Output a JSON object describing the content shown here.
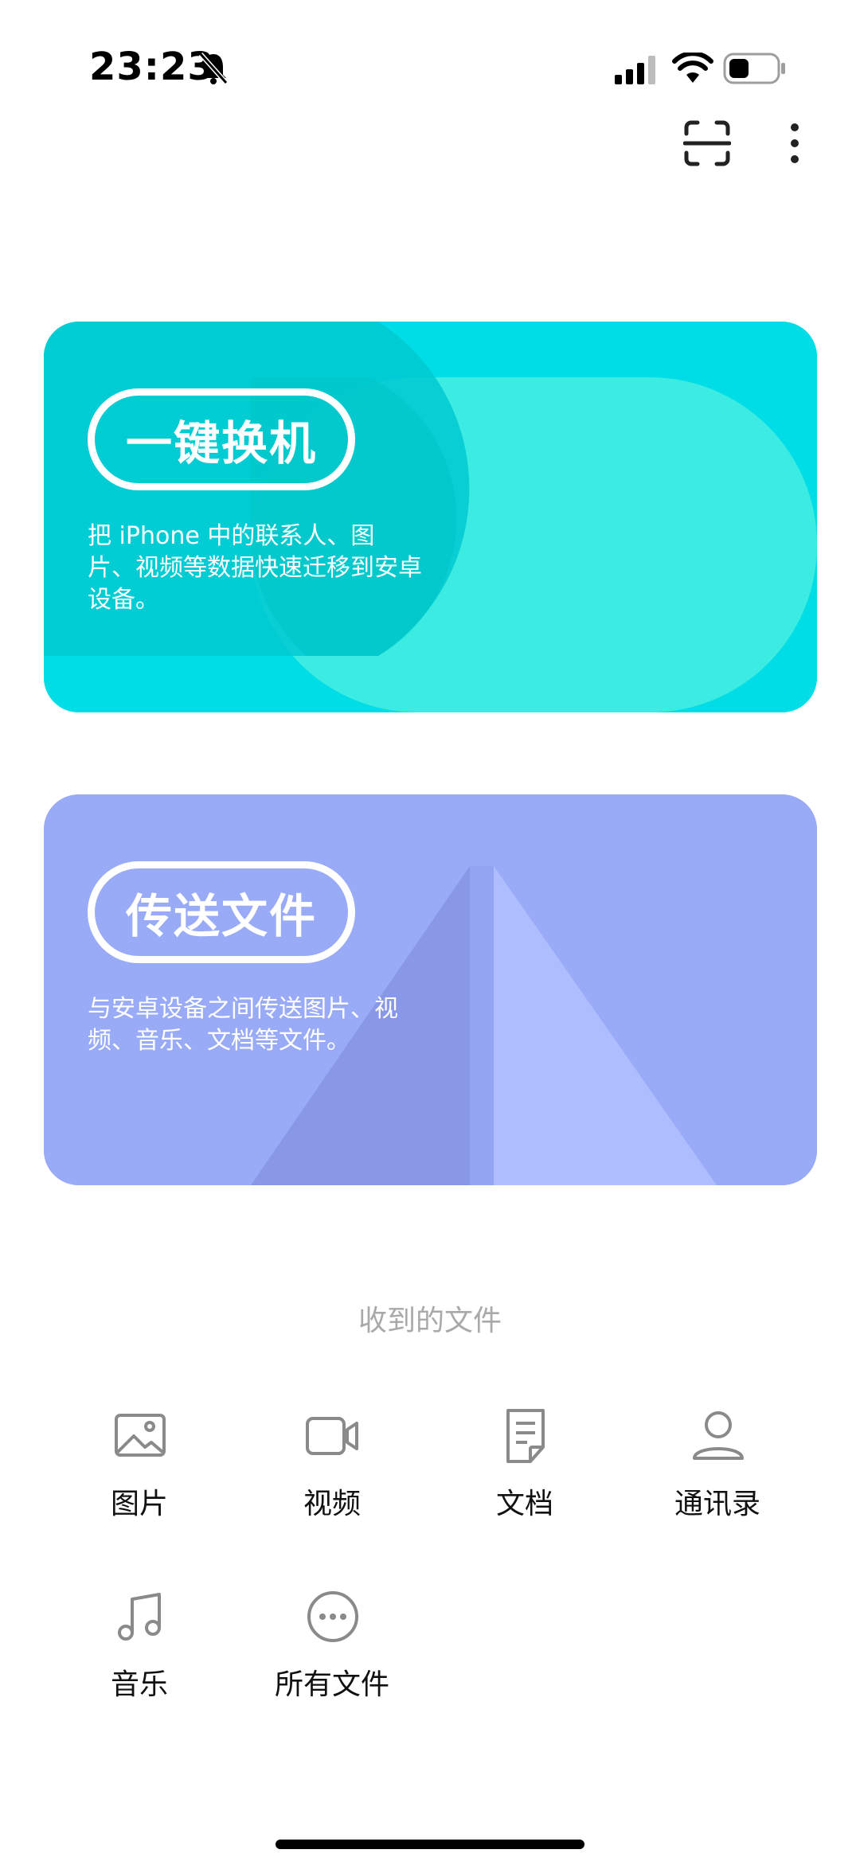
{
  "status_bar": {
    "time": "23:23",
    "icons": [
      "bell-muted-icon",
      "signal-icon",
      "wifi-icon",
      "battery-icon"
    ]
  },
  "toolbar": {
    "icons": [
      "scan-icon",
      "more-icon"
    ]
  },
  "cards": {
    "switch": {
      "title": "一键换机",
      "description": "把 iPhone 中的联系人、图片、视频等数据快速迁移到安卓设备。",
      "color": "#00dde6"
    },
    "transfer": {
      "title": "传送文件",
      "description": "与安卓设备之间传送图片、视频、音乐、文档等文件。",
      "color": "#99abf7"
    }
  },
  "received": {
    "title": "收到的文件",
    "items": [
      {
        "label": "图片",
        "icon": "image-icon"
      },
      {
        "label": "视频",
        "icon": "video-icon"
      },
      {
        "label": "文档",
        "icon": "document-icon"
      },
      {
        "label": "通讯录",
        "icon": "contact-icon"
      },
      {
        "label": "音乐",
        "icon": "music-icon"
      },
      {
        "label": "所有文件",
        "icon": "more-files-icon"
      }
    ]
  }
}
